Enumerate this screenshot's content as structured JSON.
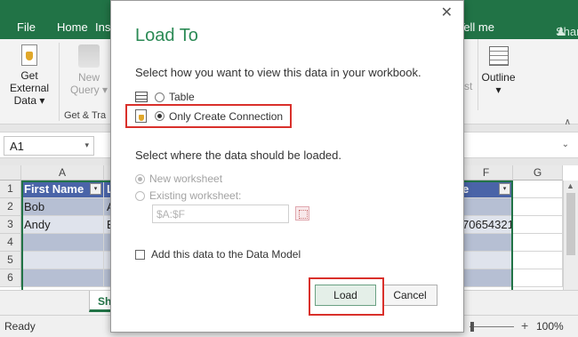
{
  "colors": {
    "excel_green": "#217346",
    "dialog_title": "#2b8a55",
    "highlight_red": "#d9302b",
    "table_header": "#4a64a8",
    "table_band": "#b6bfd3"
  },
  "ribbon": {
    "tabs": {
      "file": "File",
      "home": "Home",
      "insert_partial": "Ins",
      "tellme": "Tell me",
      "share": "Share"
    },
    "get_external_data": {
      "line1": "Get External",
      "line2": "Data ▾"
    },
    "new_query": {
      "line1": "New",
      "line2": "Query ▾"
    },
    "group_label": "Get & Tra",
    "stray_text": "st",
    "outline": {
      "label": "Outline",
      "arrow": "▾"
    },
    "collapse": "∧",
    "share_icon": "person-icon"
  },
  "formula_bar": {
    "namebox": "A1",
    "namebox_caret": "▾",
    "expand_caret": "⌄"
  },
  "grid": {
    "col_a": "A",
    "col_f": "F",
    "col_g": "G",
    "rows": [
      "1",
      "2",
      "3",
      "4",
      "5",
      "6"
    ],
    "header_cells": {
      "first_name": "First Name",
      "second_partial": "L",
      "last_partial": "e"
    },
    "row2": {
      "a": "Bob",
      "b": "A"
    },
    "row3": {
      "a": "Andy",
      "b": "E",
      "f": "70654321"
    },
    "filter_glyph": "▾"
  },
  "sheet_tab": "Sh",
  "status": {
    "ready": "Ready",
    "zoom_plus": "+",
    "zoom_pct": "100%"
  },
  "dialog": {
    "close": "✕",
    "title": "Load To",
    "question1": "Select how you want to view this data in your workbook.",
    "option_table": "Table",
    "option_connection": "Only Create Connection",
    "question2": "Select where the data should be loaded.",
    "option_new_ws": "New worksheet",
    "option_existing_ws": "Existing worksheet:",
    "range_value": "$A:$F",
    "add_to_model": "Add this data to the Data Model",
    "load_button": "Load",
    "cancel_button": "Cancel",
    "selected_view": "Only Create Connection",
    "selected_location": "New worksheet",
    "add_to_model_checked": false
  }
}
